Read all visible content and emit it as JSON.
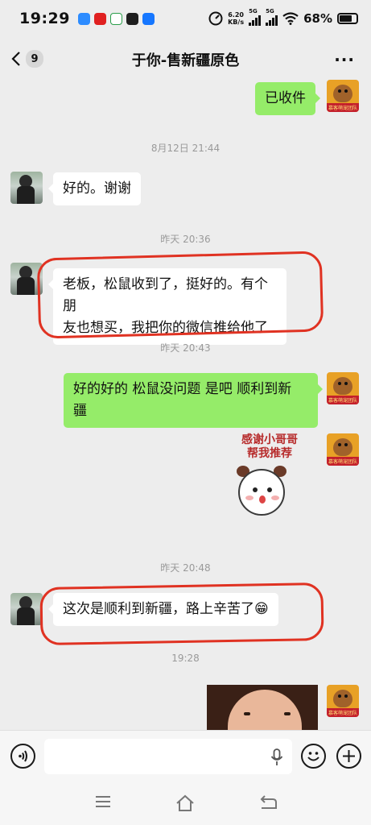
{
  "status_bar": {
    "time": "19:29",
    "net_speed_value": "6.20",
    "net_speed_unit": "KB/s",
    "sim1_label": "5G",
    "sim2_label": "5G",
    "battery": "68%",
    "app_icons": [
      "weather-icon",
      "hsbc-icon",
      "photos-icon",
      "alipay-icon",
      "message-icon"
    ]
  },
  "header": {
    "unread_count": "9",
    "title": "于你-售新疆原色"
  },
  "avatar_badge_text": "慕客萌宠团队",
  "messages": [
    {
      "side": "out",
      "text": "已收件"
    },
    {
      "timestamp": "8月12日 21:44"
    },
    {
      "side": "in",
      "text": "好的。谢谢"
    },
    {
      "timestamp": "昨天 20:36"
    },
    {
      "side": "in",
      "lines": [
        "老板，松鼠收到了，挺好的。有个朋",
        "友也想买，我把你的微信推给他了"
      ],
      "highlighted": true
    },
    {
      "timestamp": "昨天 20:43"
    },
    {
      "side": "out",
      "lines": [
        "好的好的 松鼠没问题 是吧  顺利到新",
        "疆"
      ]
    },
    {
      "side": "out",
      "sticker_caption": [
        "感谢小哥哥",
        "帮我推荐"
      ]
    },
    {
      "timestamp": "昨天 20:48"
    },
    {
      "side": "in",
      "text": "这次是顺利到新疆，路上辛苦了😁",
      "highlighted": true
    },
    {
      "timestamp": "19:28"
    },
    {
      "side": "out",
      "type": "photo"
    }
  ],
  "input_bar": {
    "placeholder": ""
  }
}
